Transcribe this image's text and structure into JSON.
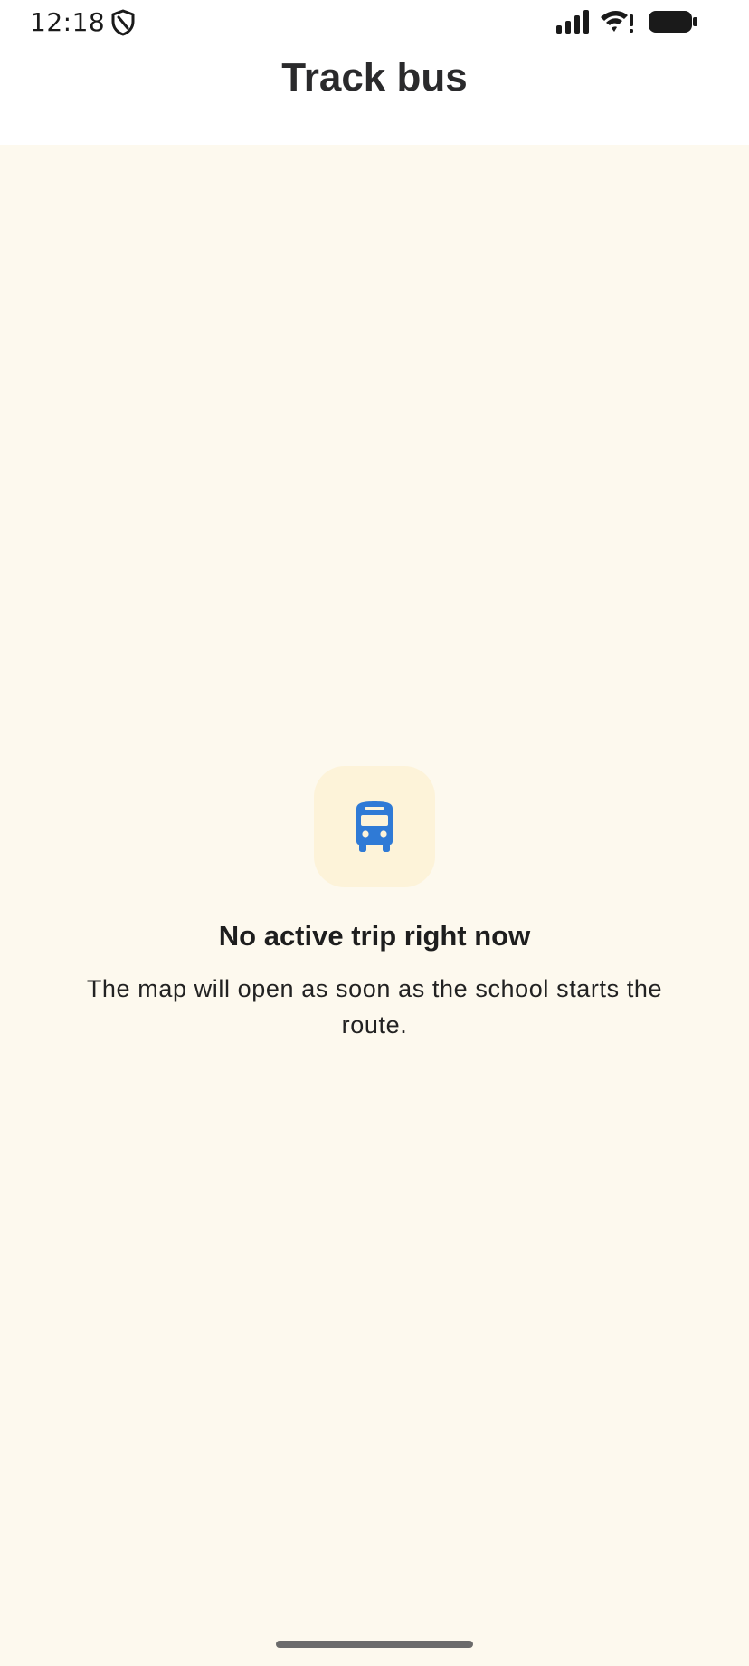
{
  "status_bar": {
    "time": "12:18",
    "left_icons": [
      "shield-icon"
    ],
    "right_icons": [
      "signal-icon",
      "wifi-alert-icon",
      "battery-icon"
    ]
  },
  "app_bar": {
    "title": "Track bus"
  },
  "empty_state": {
    "icon": "bus-icon",
    "title": "No active trip right now",
    "description": "The map will open as soon as the school starts the route."
  },
  "colors": {
    "background": "#fdf9ee",
    "app_bar": "#ffffff",
    "icon_tile": "#fdf3d9",
    "accent_blue": "#2f7ad6",
    "text_primary": "#1e1e1e"
  }
}
